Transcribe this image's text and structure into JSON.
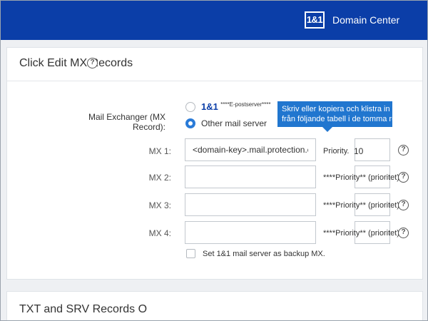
{
  "header": {
    "logo_text": "1&1",
    "title": "Domain Center"
  },
  "mx_section": {
    "title": "Click Edit MX Records",
    "mail_exchanger_label": "Mail Exchanger (MX Record):",
    "option_1and1_brand": "1&1",
    "option_1and1_note": "****E-postserver****",
    "option_other": "Other mail server",
    "selected_option": "Other mail server",
    "tooltip_line1": "Skriv eller kopiera och klistra in",
    "tooltip_line2": "från följande tabell i de tomma ru",
    "rows": [
      {
        "label": "MX 1:",
        "value": "<domain-key>.mail.protection.o",
        "priority_label": "Priority.",
        "priority_value": "10"
      },
      {
        "label": "MX 2:",
        "value": "",
        "priority_label": "****Priority** (prioritet)",
        "priority_value": ""
      },
      {
        "label": "MX 3:",
        "value": "",
        "priority_label": "****Priority** (prioritet)",
        "priority_value": ""
      },
      {
        "label": "MX 4:",
        "value": "",
        "priority_label": "****Priority** (prioritet)",
        "priority_value": ""
      }
    ],
    "backup_checkbox_label": "Set 1&1 mail server as backup MX.",
    "backup_checked": false
  },
  "txt_section": {
    "title": "TXT and SRV Records O"
  },
  "colors": {
    "brand_blue": "#0b3ea8",
    "tooltip_blue": "#2176cf",
    "radio_selected": "#2a7bd8"
  },
  "icons": {
    "help": "question-circle-icon"
  }
}
